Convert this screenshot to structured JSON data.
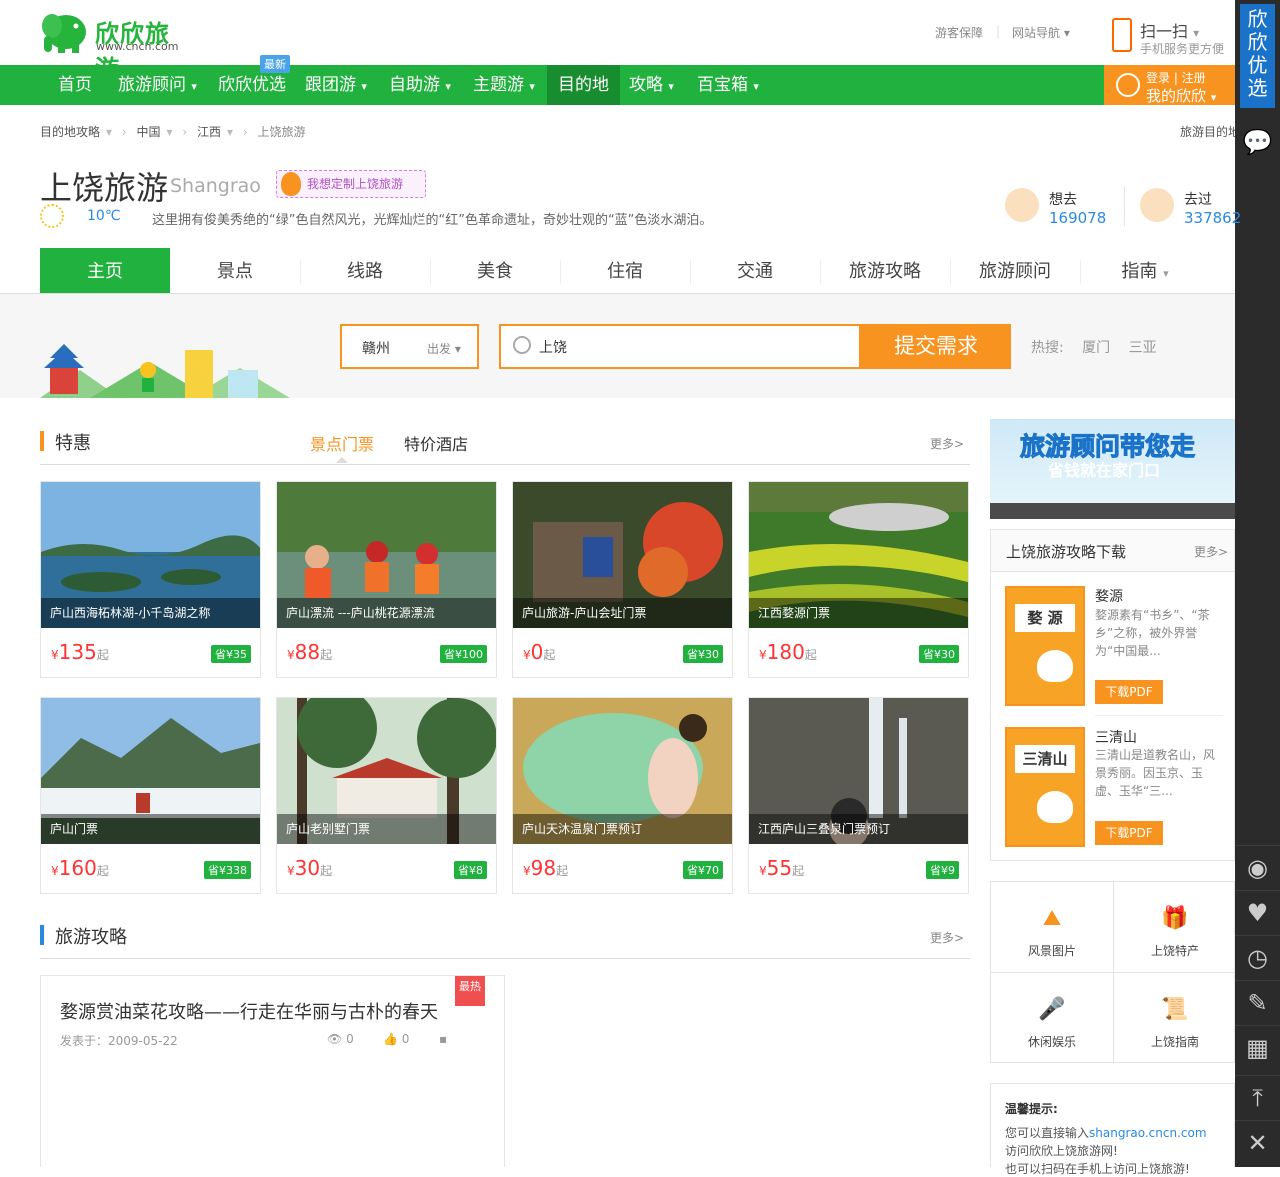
{
  "header": {
    "logo_text": "欣欣旅游",
    "logo_url": "www.cncn.com",
    "links": [
      "游客保障",
      "网站导航"
    ],
    "scan": {
      "title": "扫一扫",
      "subtitle": "手机服务更方便"
    }
  },
  "nav": {
    "items": [
      "首页",
      "旅游顾问",
      "欣欣优选",
      "跟团游",
      "自助游",
      "主题游",
      "目的地",
      "攻略",
      "百宝箱"
    ],
    "badge": "最新",
    "login": {
      "line1": "登录 | 注册",
      "line2": "我的欣欣"
    }
  },
  "sidebar": {
    "top_label": "欣欣优选"
  },
  "breadcrumb": [
    "目的地攻略",
    "中国",
    "江西",
    "上饶旅游"
  ],
  "breadcrumb_right": "旅游目的地",
  "destination": {
    "title": "上饶旅游",
    "title_en": "Shangrao",
    "custom_btn": "我想定制上饶旅游",
    "temperature": "10℃",
    "description": "这里拥有俊美秀绝的“绿”色自然风光，光辉灿烂的“红”色革命遗址，奇妙壮观的“蓝”色淡水湖泊。",
    "want": {
      "label": "想去",
      "value": "169078"
    },
    "been": {
      "label": "去过",
      "value": "337862"
    }
  },
  "tabs": [
    "主页",
    "景点",
    "线路",
    "美食",
    "住宿",
    "交通",
    "旅游攻略",
    "旅游顾问",
    "指南"
  ],
  "search": {
    "departure": "赣州",
    "departure_label": "出发",
    "query": "上饶",
    "submit": "提交需求",
    "hot_label": "热搜:",
    "hot": [
      "厦门",
      "三亚"
    ]
  },
  "deals": {
    "title": "特惠",
    "subtabs": [
      "景点门票",
      "特价酒店"
    ],
    "more": "更多>",
    "cards": [
      {
        "name": "庐山西海柘林湖-小千岛湖之称",
        "price": "135",
        "save": "省¥35"
      },
      {
        "name": "庐山漂流 ---庐山桃花源漂流",
        "price": "88",
        "save": "省¥100"
      },
      {
        "name": "庐山旅游-庐山会址门票",
        "price": "0",
        "save": "省¥30"
      },
      {
        "name": "江西婺源门票",
        "price": "180",
        "save": "省¥30"
      },
      {
        "name": "庐山门票",
        "price": "160",
        "save": "省¥338"
      },
      {
        "name": "庐山老别墅门票",
        "price": "30",
        "save": "省¥8"
      },
      {
        "name": "庐山天沐温泉门票预订",
        "price": "98",
        "save": "省¥70"
      },
      {
        "name": "江西庐山三叠泉门票预订",
        "price": "55",
        "save": "省¥9"
      }
    ],
    "currency": "¥",
    "suffix": "起"
  },
  "guides": {
    "title": "旅游攻略",
    "more": "更多>",
    "item": {
      "title": "婺源赏油菜花攻略——行走在华丽与古朴的春天",
      "badge": "最热",
      "date": "发表于：2009-05-22",
      "views": "0",
      "likes": "0"
    }
  },
  "right": {
    "banner_line1": "旅游顾问带您走",
    "banner_line2": "省钱就在家门口",
    "downloads": {
      "title": "上饶旅游攻略下载",
      "more": "更多>",
      "items": [
        {
          "cover": "婺 源",
          "name": "婺源",
          "desc": "婺源素有“书乡”、“茶乡”之称，被外界誉为“中国最...",
          "btn": "下载PDF"
        },
        {
          "cover": "三清山",
          "name": "三清山",
          "desc": "三清山是道教名山，风景秀丽。因玉京、玉虚、玉华“三...",
          "btn": "下载PDF"
        }
      ]
    },
    "grid": [
      "风景图片",
      "上饶特产",
      "休闲娱乐",
      "上饶指南"
    ],
    "tip": {
      "title": "温馨提示:",
      "line1": "您可以直接输入",
      "domain": "shangrao.cncn.com",
      "line2": "访问欣欣上饶旅游网!",
      "line3": "也可以扫码在手机上访问上饶旅游!"
    }
  },
  "colors": {
    "brand_green": "#20b13e",
    "accent_orange": "#f7931e",
    "link_blue": "#2a8ae0",
    "price_red": "#ff3333"
  }
}
